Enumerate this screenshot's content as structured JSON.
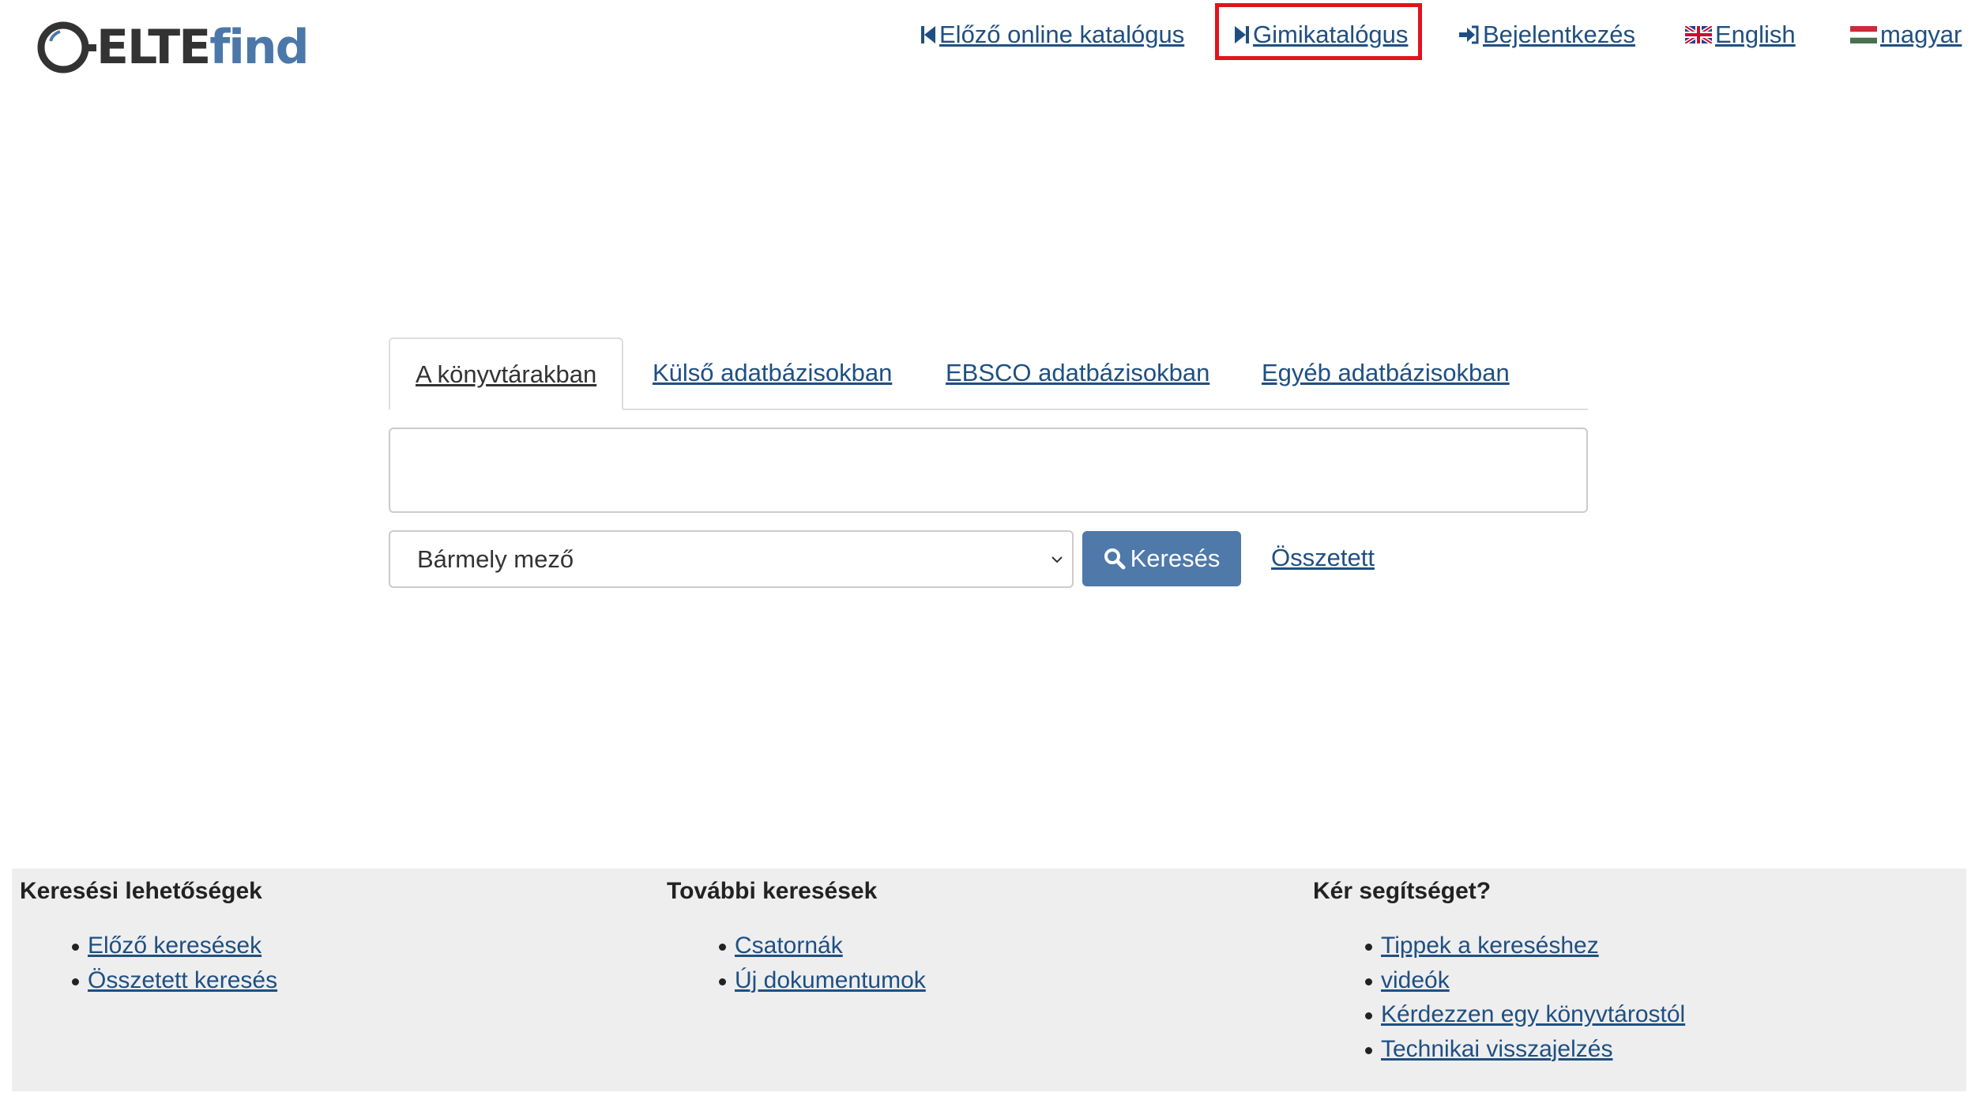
{
  "header": {
    "logo": {
      "elte": "ELTE",
      "find": "find"
    },
    "nav": [
      {
        "label": "Előző online katalógus",
        "icon": "step-backward-icon"
      },
      {
        "label": "Gimikatalógus",
        "icon": "step-forward-icon"
      },
      {
        "label": "Bejelentkezés",
        "icon": "sign-in-icon"
      },
      {
        "label": "English",
        "icon": "uk-flag-icon"
      },
      {
        "label": "magyar",
        "icon": "hungary-flag-icon"
      }
    ]
  },
  "search": {
    "tabs": [
      "A könyvtárakban",
      "Külső adatbázisokban",
      "EBSCO adatbázisokban",
      "Egyéb adatbázisokban"
    ],
    "active_tab": "A könyvtárakban",
    "input_value": "",
    "type_select": "Bármely mező",
    "button_label": "Keresés",
    "advanced_link": "Összetett"
  },
  "footer": {
    "columns": [
      {
        "title": "Keresési lehetőségek",
        "links": [
          "Előző keresések",
          "Összetett keresés"
        ]
      },
      {
        "title": "További keresések",
        "links": [
          "Csatornák",
          "Új dokumentumok"
        ]
      },
      {
        "title": "Kér segítséget?",
        "links": [
          "Tippek a kereséshez",
          "videók",
          "Kérdezzen egy könyvtárostól",
          "Technikai visszajelzés"
        ]
      }
    ]
  },
  "colors": {
    "link": "#1f4f82",
    "button": "#4e79a9",
    "highlight": "#e0141e",
    "footer_bg": "#eeeeee"
  }
}
